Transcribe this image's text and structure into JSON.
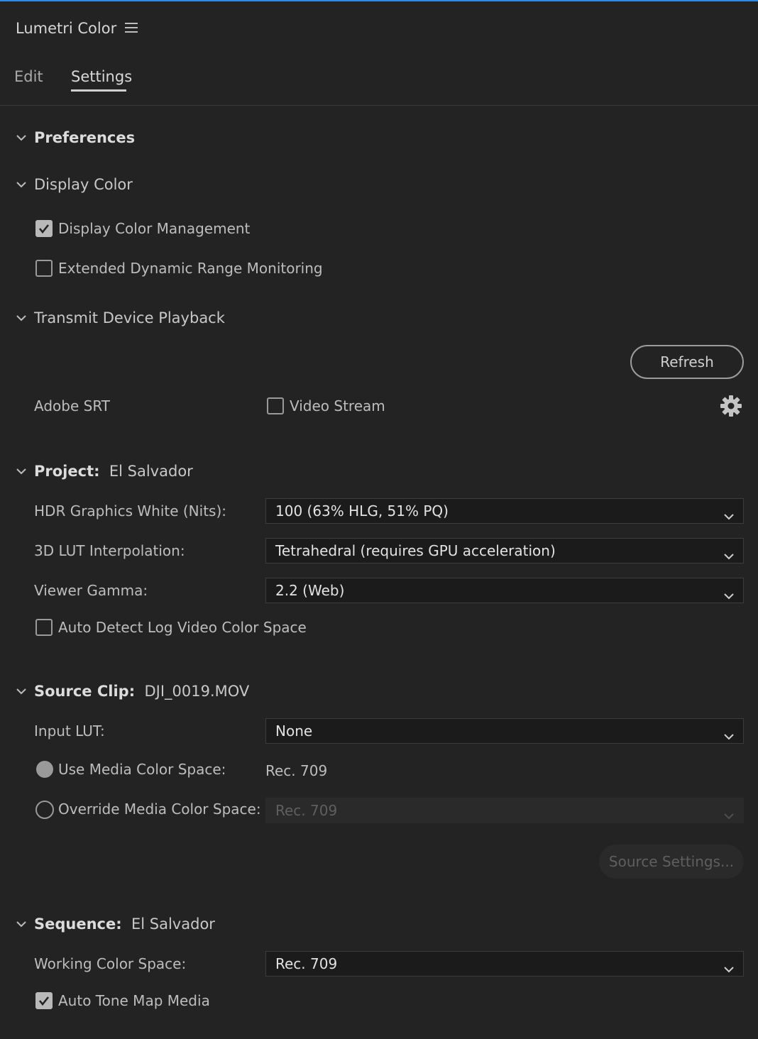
{
  "panel": {
    "title": "Lumetri Color",
    "menu_icon": "hamburger-icon"
  },
  "tabs": [
    {
      "label": "Edit",
      "active": false
    },
    {
      "label": "Settings",
      "active": true
    }
  ],
  "preferences": {
    "title": "Preferences"
  },
  "display_color": {
    "title": "Display Color",
    "display_color_management": {
      "label": "Display Color Management",
      "checked": true
    },
    "edr_monitoring": {
      "label": "Extended Dynamic Range Monitoring",
      "checked": false
    }
  },
  "transmit": {
    "title": "Transmit Device Playback",
    "refresh_label": "Refresh",
    "device_label": "Adobe SRT",
    "video_stream": {
      "label": "Video Stream",
      "checked": false
    },
    "settings_icon": "gear-icon"
  },
  "project": {
    "title": "Project:",
    "name": "El Salvador",
    "hdr_white": {
      "label": "HDR Graphics White (Nits):",
      "value": "100 (63% HLG, 51% PQ)"
    },
    "lut_interp": {
      "label": "3D LUT Interpolation:",
      "value": "Tetrahedral (requires GPU acceleration)"
    },
    "viewer_gamma": {
      "label": "Viewer Gamma:",
      "value": "2.2 (Web)"
    },
    "auto_detect_log": {
      "label": "Auto Detect Log Video Color Space",
      "checked": false
    }
  },
  "source_clip": {
    "title": "Source Clip:",
    "name": "DJI_0019.MOV",
    "input_lut": {
      "label": "Input LUT:",
      "value": "None"
    },
    "use_media": {
      "label": "Use Media Color Space:",
      "value": "Rec. 709",
      "selected": true
    },
    "override_media": {
      "label": "Override Media Color Space:",
      "value": "Rec. 709",
      "selected": false
    },
    "source_settings_label": "Source Settings..."
  },
  "sequence": {
    "title": "Sequence:",
    "name": "El Salvador",
    "working_space": {
      "label": "Working Color Space:",
      "value": "Rec. 709"
    },
    "auto_tone_map": {
      "label": "Auto Tone Map Media",
      "checked": true
    }
  },
  "colors": {
    "accent": "#2d8ceb",
    "background": "#232323",
    "dropdown_bg": "#1b1b1b"
  }
}
